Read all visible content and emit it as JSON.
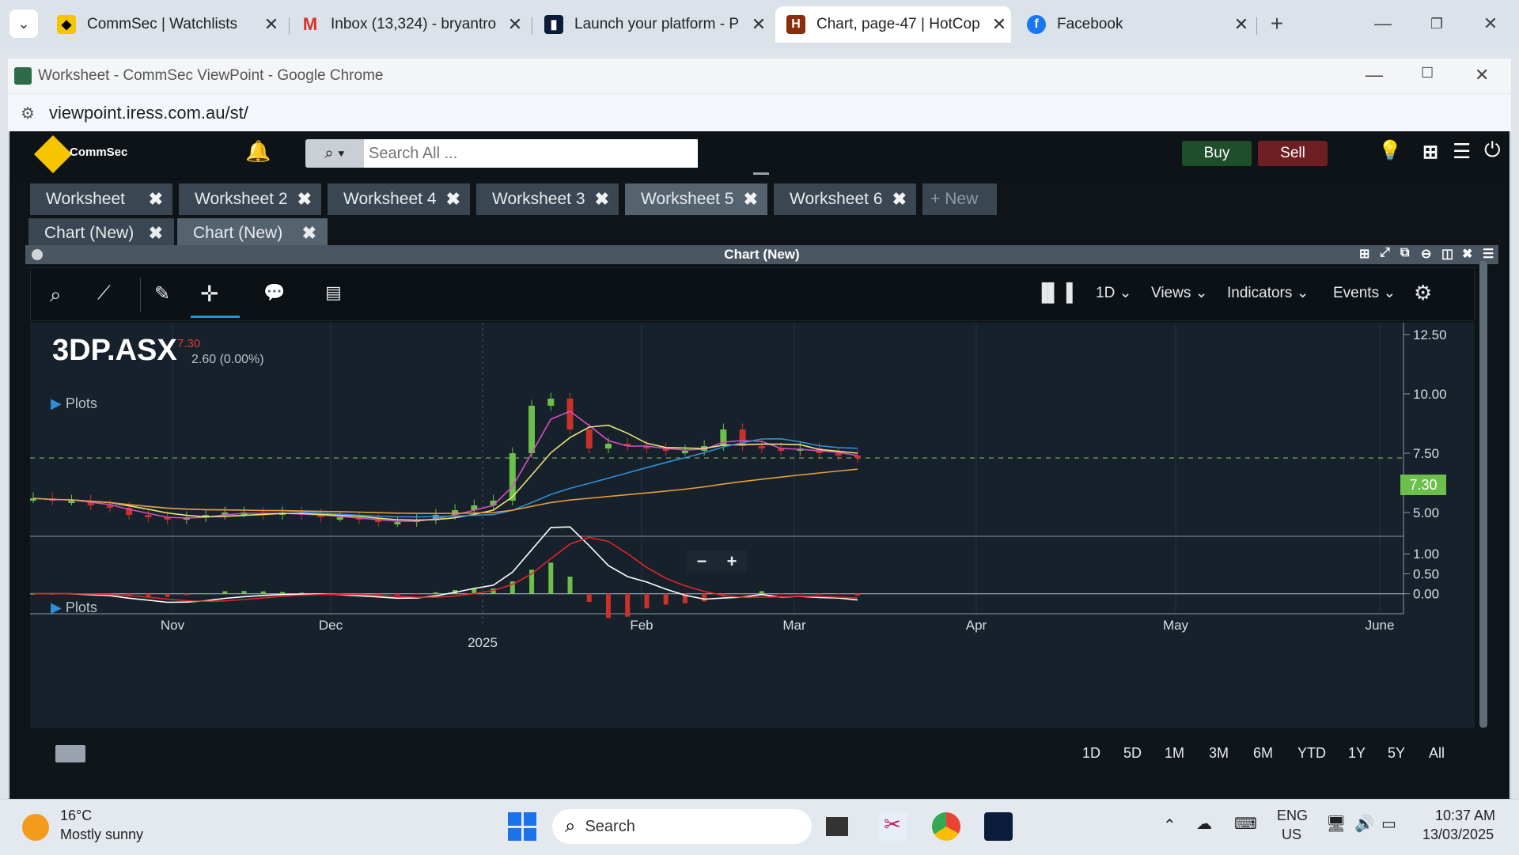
{
  "browser": {
    "tabs": [
      {
        "label": "CommSec | Watchlists",
        "icon": "commsec-icon"
      },
      {
        "label": "Inbox (13,324) - bryantro",
        "icon": "gmail-icon"
      },
      {
        "label": "Launch your platform - P",
        "icon": "platform-icon"
      },
      {
        "label": "Chart, page-47 | HotCop",
        "icon": "hotcopper-icon",
        "active": true
      },
      {
        "label": "Facebook",
        "icon": "facebook-icon"
      }
    ],
    "window_title": "Worksheet - CommSec ViewPoint - Google Chrome",
    "url": "viewpoint.iress.com.au/st/"
  },
  "app": {
    "brand": "CommSec",
    "search_placeholder": "Search All ...",
    "buy_label": "Buy",
    "sell_label": "Sell",
    "worksheet_tabs": [
      "Worksheet",
      "Worksheet 2",
      "Worksheet 4",
      "Worksheet 3",
      "Worksheet 5",
      "Worksheet 6"
    ],
    "active_worksheet": "Worksheet 5",
    "new_tab_label": "New",
    "chart_tabs": [
      "Chart (New)",
      "Chart (New)"
    ],
    "panel_title": "Chart (New)",
    "toolbar": {
      "interval": "1D",
      "views": "Views",
      "indicators": "Indicators",
      "events": "Events"
    },
    "ranges": [
      "1D",
      "5D",
      "1M",
      "3M",
      "6M",
      "YTD",
      "1Y",
      "5Y",
      "All"
    ]
  },
  "chart_data": {
    "type": "candlestick",
    "symbol": "3DP.ASX",
    "last_price": "7.30",
    "change": "2.60 (0.00%)",
    "price_label": "7.30",
    "plots_label": "Plots",
    "price_axis": {
      "ticks": [
        "12.50",
        "10.00",
        "7.50",
        "5.00"
      ],
      "range": [
        4.0,
        13.0
      ]
    },
    "indicator_axis": {
      "ticks": [
        "1.00",
        "0.50",
        "0.00"
      ],
      "range": [
        -0.5,
        1.4
      ]
    },
    "x_axis": {
      "ticks": [
        "Nov",
        "Dec",
        "Feb",
        "Mar",
        "Apr",
        "May",
        "June"
      ],
      "year_label": "2025"
    },
    "series": [
      {
        "name": "price",
        "color": "#c9322a",
        "values": [
          5.6,
          5.5,
          5.5,
          5.3,
          5.2,
          4.9,
          4.8,
          4.7,
          4.8,
          4.9,
          5.0,
          5.0,
          4.9,
          5.0,
          4.9,
          4.8,
          4.8,
          4.7,
          4.6,
          4.6,
          4.7,
          4.9,
          5.1,
          5.3,
          5.5,
          7.5,
          9.5,
          9.8,
          8.5,
          7.7,
          7.9,
          7.8,
          7.7,
          7.6,
          7.6,
          7.8,
          8.5,
          7.8,
          7.7,
          7.6,
          7.7,
          7.5,
          7.4,
          7.3
        ]
      },
      {
        "name": "ma-short",
        "color": "#d94fc1"
      },
      {
        "name": "ma-mid",
        "color": "#e8e37a"
      },
      {
        "name": "ma-long",
        "color": "#2f8fd6"
      },
      {
        "name": "ma-vlong",
        "color": "#e89c3c"
      }
    ]
  },
  "taskbar": {
    "weather_temp": "16°C",
    "weather_desc": "Mostly sunny",
    "search_label": "Search",
    "lang": "ENG",
    "region": "US",
    "time": "10:37 AM",
    "date": "13/03/2025"
  },
  "colors": {
    "app_bg": "#0f1418",
    "chart_bg": "#17212b",
    "buy": "#1f4f2a",
    "sell": "#6d1f22",
    "up": "#6cbf4a",
    "down": "#c9322a"
  }
}
